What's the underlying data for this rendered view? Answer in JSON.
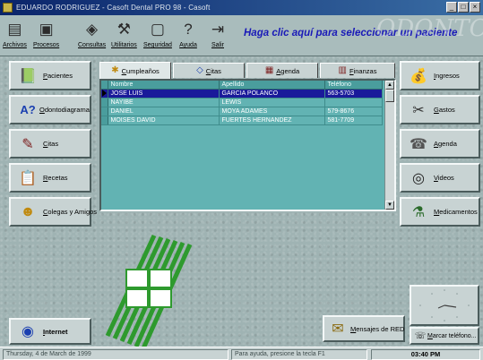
{
  "window": {
    "title": "EDUARDO RODRIGUEZ - Casoft Dental PRO 98 - Casoft",
    "controls": [
      "_",
      "□",
      "×"
    ]
  },
  "toolbar": {
    "items": [
      {
        "label": "Archivos",
        "icon": "file-cabinet-icon"
      },
      {
        "label": "Procesos",
        "icon": "process-icon"
      },
      {
        "label": "Consultas",
        "icon": "query-icon"
      },
      {
        "label": "Utilitarios",
        "icon": "tools-icon"
      },
      {
        "label": "Seguridad",
        "icon": "security-icon"
      },
      {
        "label": "Ayuda",
        "icon": "help-icon"
      },
      {
        "label": "Salir",
        "icon": "exit-icon"
      }
    ],
    "headline": "Haga clic aquí para seleccionar un paciente"
  },
  "left_buttons": [
    {
      "label": "Pacientes",
      "icon": "patients-icon"
    },
    {
      "label": "Odontodiagrama",
      "icon": "odontogram-icon"
    },
    {
      "label": "Citas",
      "icon": "appointments-icon"
    },
    {
      "label": "Recetas",
      "icon": "prescriptions-icon"
    },
    {
      "label": "Colegas y Amigos",
      "icon": "colleagues-icon"
    }
  ],
  "right_buttons": [
    {
      "label": "Ingresos",
      "icon": "income-icon"
    },
    {
      "label": "Gastos",
      "icon": "expenses-icon"
    },
    {
      "label": "Agenda",
      "icon": "agenda-icon"
    },
    {
      "label": "Videos",
      "icon": "videos-icon"
    },
    {
      "label": "Medicamentos",
      "icon": "medicines-icon"
    }
  ],
  "tabs": [
    {
      "label": "Cumpleaños",
      "icon": "birthday-icon",
      "active": true
    },
    {
      "label": "Citas",
      "icon": "appointments-icon",
      "active": false
    },
    {
      "label": "Agenda",
      "icon": "agenda-icon",
      "active": false
    },
    {
      "label": "Finanzas",
      "icon": "finance-icon",
      "active": false
    }
  ],
  "grid": {
    "columns": [
      "Nombre",
      "Apellido",
      "Teléfono"
    ],
    "rows": [
      {
        "nombre": "JOSE LUIS",
        "apellido": "GARCIA POLANCO",
        "telefono": "563-5703",
        "selected": true
      },
      {
        "nombre": "NAYIBE",
        "apellido": "LEWIS",
        "telefono": ""
      },
      {
        "nombre": "DANIEL",
        "apellido": "MOYA ADAMES",
        "telefono": "579-8676"
      },
      {
        "nombre": "MOISES DAVID",
        "apellido": "FUERTES HERNANDEZ",
        "telefono": "581-7709"
      }
    ]
  },
  "bottom": {
    "internet": "Internet",
    "mensajes": "Mensajes de RED",
    "marcar": "Marcar teléfono..."
  },
  "status": {
    "date": "Thursday, 4 de March de 1999",
    "hint": "Para ayuda, presione la tecla F1",
    "time": "03:40 PM"
  },
  "colors": {
    "title_bar": "#0a246a",
    "headline": "#1a1ab8",
    "grid_bg": "#62b3b3",
    "selection": "#1a1a9a",
    "logo_green": "#2e9a2e"
  }
}
